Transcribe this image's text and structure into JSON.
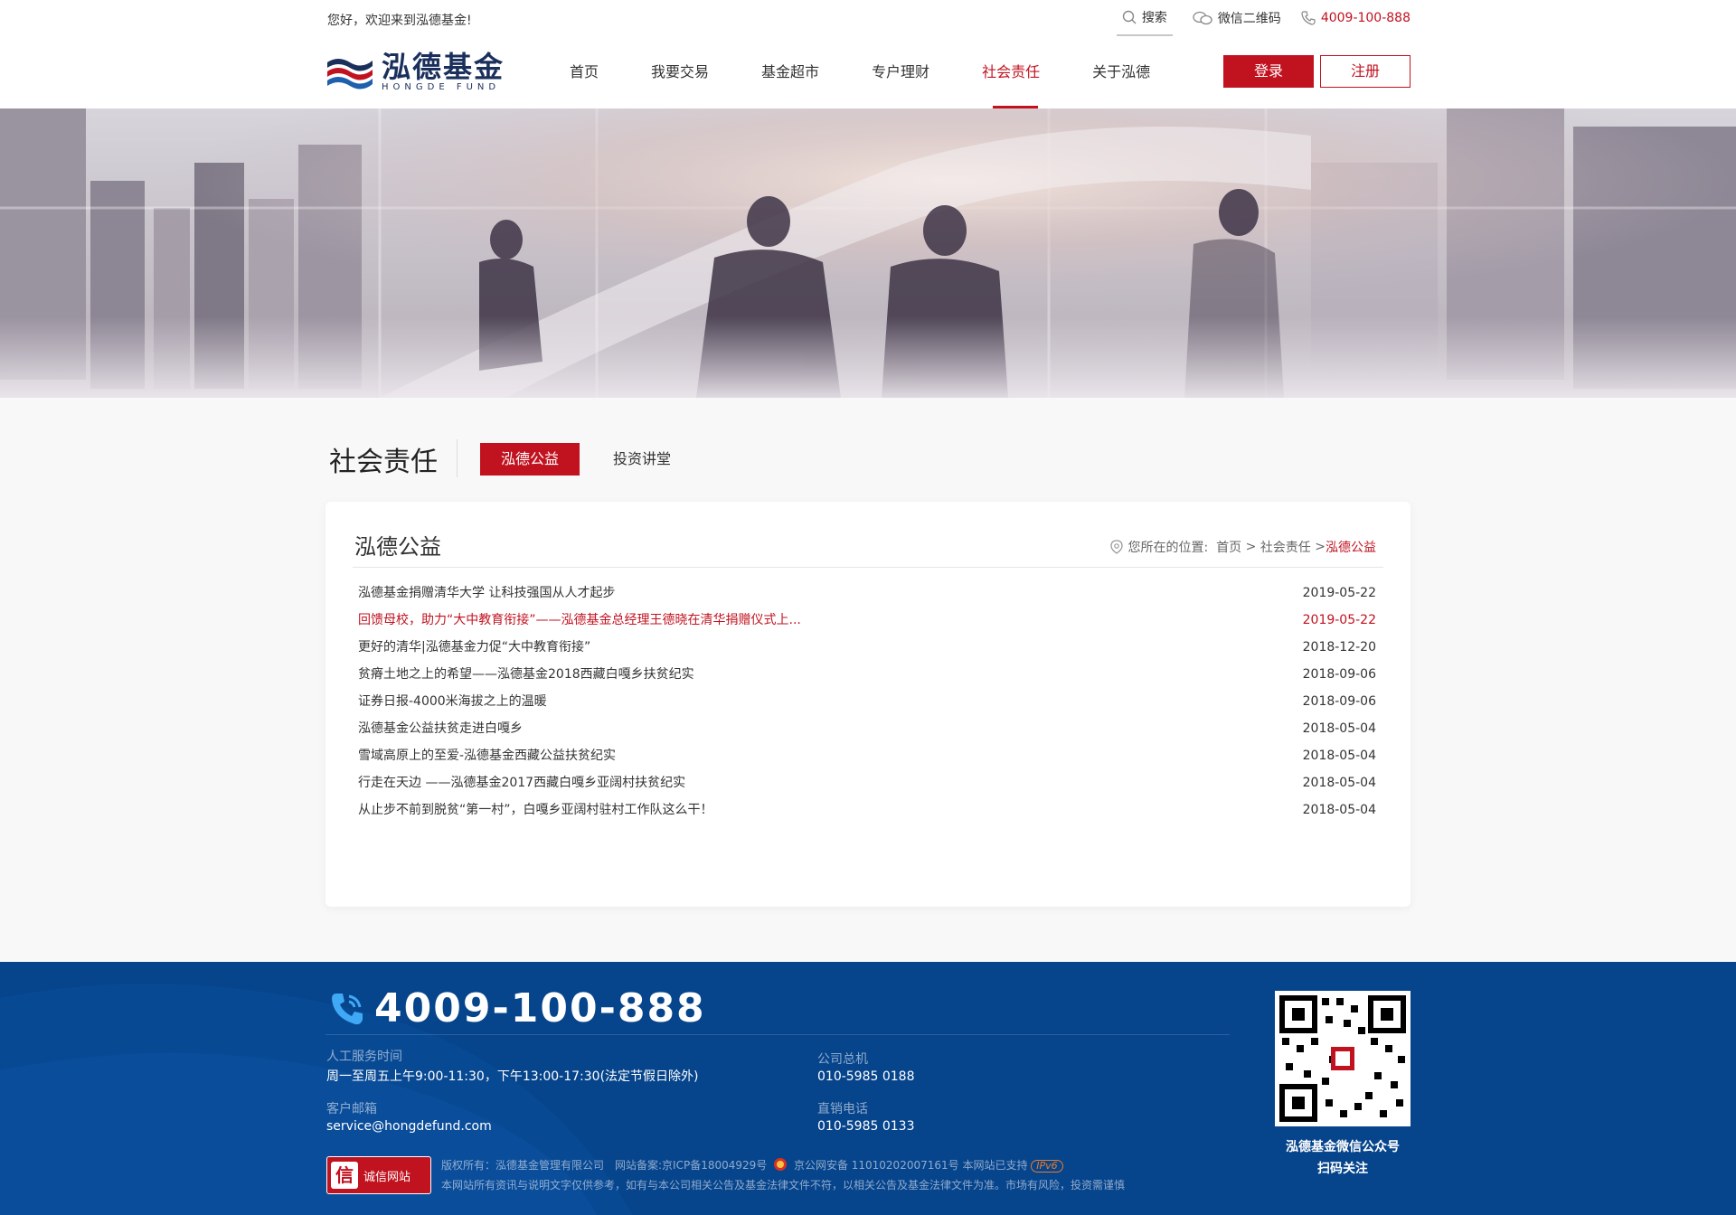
{
  "topbar": {
    "welcome": "您好，欢迎来到泓德基金!",
    "search": "搜索",
    "wechat_qr": "微信二维码",
    "hotline": "4009-100-888"
  },
  "header": {
    "logo_cn": "泓德基金",
    "logo_en": "HONGDE FUND",
    "nav": [
      "首页",
      "我要交易",
      "基金超市",
      "专户理财",
      "社会责任",
      "关于泓德"
    ],
    "active_nav": "社会责任",
    "login": "登录",
    "register": "注册"
  },
  "section": {
    "title": "社会责任",
    "tabs": [
      "泓德公益",
      "投资讲堂"
    ],
    "active_tab": "泓德公益"
  },
  "card": {
    "title": "泓德公益",
    "breadcrumb": {
      "label": "您所在的位置:",
      "home": "首页",
      "sep": ">",
      "parent": "社会责任",
      "current": "泓德公益"
    },
    "news": [
      {
        "title": "泓德基金捐赠清华大学 让科技强国从人才起步",
        "date": "2019-05-22",
        "highlight": false
      },
      {
        "title": "回馈母校，助力“大中教育衔接”——泓德基金总经理王德晓在清华捐赠仪式上...",
        "date": "2019-05-22",
        "highlight": true
      },
      {
        "title": "更好的清华|泓德基金力促“大中教育衔接”",
        "date": "2018-12-20",
        "highlight": false
      },
      {
        "title": "贫瘠土地之上的希望——泓德基金2018西藏白嘎乡扶贫纪实",
        "date": "2018-09-06",
        "highlight": false
      },
      {
        "title": "证券日报-4000米海拔之上的温暖",
        "date": "2018-09-06",
        "highlight": false
      },
      {
        "title": "泓德基金公益扶贫走进白嘎乡",
        "date": "2018-05-04",
        "highlight": false
      },
      {
        "title": "雪域高原上的至爱-泓德基金西藏公益扶贫纪实",
        "date": "2018-05-04",
        "highlight": false
      },
      {
        "title": "行走在天边 ——泓德基金2017西藏白嘎乡亚阔村扶贫纪实",
        "date": "2018-05-04",
        "highlight": false
      },
      {
        "title": "从止步不前到脱贫“第一村”，白嘎乡亚阔村驻村工作队这么干！",
        "date": "2018-05-04",
        "highlight": false
      }
    ]
  },
  "footer": {
    "phone": "4009-100-888",
    "service_hours_label": "人工服务时间",
    "service_hours": "周一至周五上午9:00-11:30，下午13:00-17:30(法定节假日除外)",
    "email_label": "客户邮箱",
    "email": "service@hongdefund.com",
    "hq_label": "公司总机",
    "hq": "010-5985 0188",
    "direct_label": "直销电话",
    "direct": "010-5985 0133",
    "badge": "诚信网站",
    "badge_icon": "信",
    "copyright": "版权所有：泓德基金管理有限公司　网站备案:京ICP备18004929号",
    "police": "京公网安备 11010202007161号 本网站已支持",
    "ipv6": "IPv6",
    "disclaimer": "本网站所有资讯与说明文字仅供参考，如有与本公司相关公告及基金法律文件不符，以相关公告及基金法律文件为准。市场有风险，投资需谨慎",
    "qr_caption1": "泓德基金微信公众号",
    "qr_caption2": "扫码关注"
  },
  "colors": {
    "brand_red": "#c1121f",
    "footer_blue": "#06448c",
    "logo_navy": "#1b2f5c"
  }
}
